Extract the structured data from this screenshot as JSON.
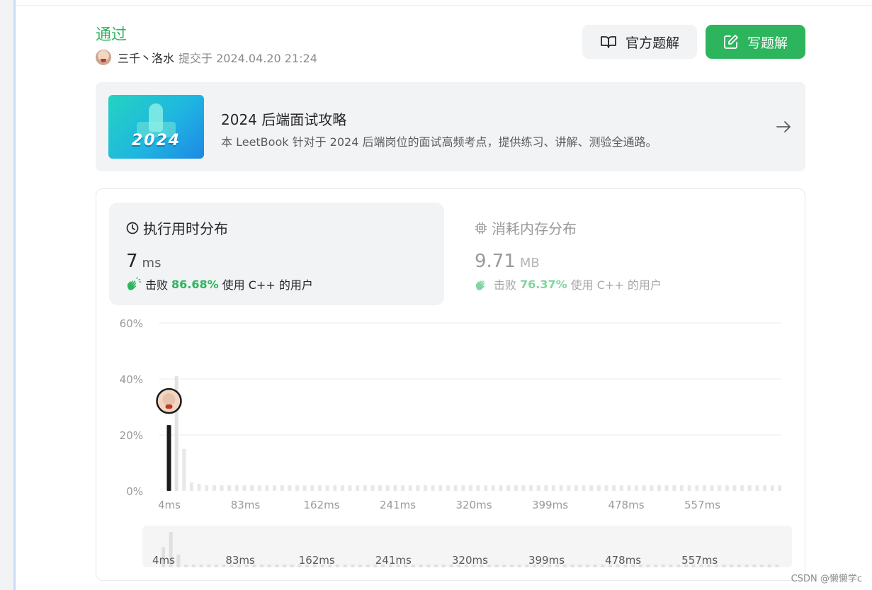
{
  "submission": {
    "status": "通过",
    "user": "三千丶洛水",
    "submitted_at": "提交于 2024.04.20 21:24"
  },
  "actions": {
    "official_solution": "官方题解",
    "write_solution": "写题解"
  },
  "leetbook": {
    "cover_text": "2024",
    "title": "2024 后端面试攻略",
    "description": "本 LeetBook 针对于 2024 后端岗位的面试高频考点，提供练习、讲解、测验全通路。"
  },
  "runtime": {
    "title": "执行用时分布",
    "value": "7",
    "unit": "ms",
    "beat_label": "击败",
    "beat_pct": "86.68%",
    "beat_suffix": "使用 C++ 的用户"
  },
  "memory": {
    "title": "消耗内存分布",
    "value": "9.71",
    "unit": "MB",
    "beat_label": "击败",
    "beat_pct": "76.37%",
    "beat_suffix": "使用 C++ 的用户"
  },
  "colors": {
    "accent": "#2db55d",
    "highlight_bar": "#1a1a1a",
    "bar": "#e8e8e8"
  },
  "chart_data": {
    "type": "bar",
    "title": "",
    "xlabel": "",
    "ylabel": "",
    "ylim": [
      0,
      60
    ],
    "y_ticks": [
      "0%",
      "20%",
      "40%",
      "60%"
    ],
    "y_tick_values": [
      0,
      20,
      40,
      60
    ],
    "x_ticks": [
      "4ms",
      "83ms",
      "162ms",
      "241ms",
      "320ms",
      "399ms",
      "478ms",
      "557ms"
    ],
    "highlight_bin": "7ms",
    "highlight_value": 23.5,
    "values": [
      23.5,
      41,
      15,
      3,
      2.5,
      2,
      2,
      2,
      2,
      2,
      2,
      2,
      2,
      2,
      2,
      2,
      2,
      2,
      2,
      2,
      2,
      2,
      2,
      2,
      2,
      2,
      2,
      2,
      2,
      2,
      2,
      2,
      2,
      2,
      2,
      2,
      2,
      2,
      2,
      2,
      2,
      2,
      2,
      2,
      2,
      2,
      2,
      2,
      2,
      2,
      2,
      2,
      2,
      2,
      2,
      2,
      2,
      2,
      2,
      2,
      2,
      2,
      2,
      2,
      2,
      2,
      2,
      2,
      2,
      2,
      2,
      2,
      2,
      2,
      2,
      2,
      2,
      2,
      2,
      2,
      2,
      2
    ],
    "grid": true,
    "overview": {
      "x_ticks": [
        "4ms",
        "83ms",
        "162ms",
        "241ms",
        "320ms",
        "399ms",
        "478ms",
        "557ms"
      ]
    }
  },
  "watermark": "CSDN @懒懒学c"
}
